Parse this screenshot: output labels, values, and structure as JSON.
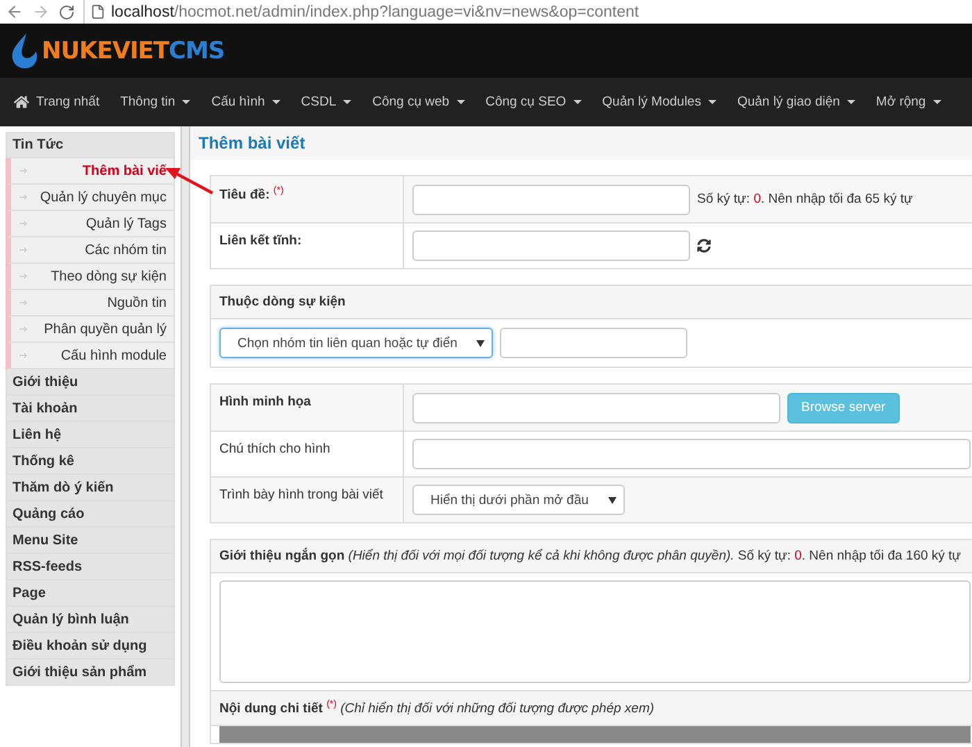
{
  "browser": {
    "host": "localhost",
    "path": "/hocmot.net/admin/index.php?language=vi&nv=news&op=content"
  },
  "logo": {
    "brand": "NUKEVIET",
    "suffix": "CMS"
  },
  "nav": [
    {
      "label": "Trang nhất",
      "kind": "home"
    },
    {
      "label": "Thông tin",
      "kind": "menu"
    },
    {
      "label": "Cấu hình",
      "kind": "menu"
    },
    {
      "label": "CSDL",
      "kind": "menu"
    },
    {
      "label": "Công cụ web",
      "kind": "menu"
    },
    {
      "label": "Công cụ SEO",
      "kind": "menu"
    },
    {
      "label": "Quản lý Modules",
      "kind": "menu"
    },
    {
      "label": "Quản lý giao diện",
      "kind": "menu"
    },
    {
      "label": "Mở rộng",
      "kind": "menu"
    }
  ],
  "sidebar": {
    "items": [
      {
        "label": "Tin Tức",
        "children": [
          {
            "label": "Thêm bài viế",
            "selected": true
          },
          {
            "label": "Quản lý chuyên mục",
            "selected": false
          },
          {
            "label": "Quản lý Tags",
            "selected": false
          },
          {
            "label": "Các nhóm tin",
            "selected": false
          },
          {
            "label": "Theo dòng sự kiện",
            "selected": false
          },
          {
            "label": "Nguồn tin",
            "selected": false
          },
          {
            "label": "Phân quyền quản lý",
            "selected": false
          },
          {
            "label": "Cấu hình module",
            "selected": false
          }
        ]
      },
      {
        "label": "Giới thiệu"
      },
      {
        "label": "Tài khoản"
      },
      {
        "label": "Liên hệ"
      },
      {
        "label": "Thống kê"
      },
      {
        "label": "Thăm dò ý kiến"
      },
      {
        "label": "Quảng cáo"
      },
      {
        "label": "Menu Site"
      },
      {
        "label": "RSS-feeds"
      },
      {
        "label": "Page"
      },
      {
        "label": "Quản lý bình luận"
      },
      {
        "label": "Điều khoản sử dụng"
      },
      {
        "label": "Giới thiệu sản phẩm"
      }
    ]
  },
  "page_title": "Thêm bài viết",
  "title_row": {
    "label": "Tiêu đề:",
    "required_mark": "(*)",
    "hint_prefix": "Số ký tự: ",
    "count": "0",
    "hint_suffix": ". Nên nhập tối đa 65 ký tự"
  },
  "slug_row": {
    "label": "Liên kết tĩnh:"
  },
  "event_panel": {
    "heading": "Thuộc dòng sự kiện",
    "select": "Chọn nhóm tin liên quan hoặc tự điển"
  },
  "image_rows": [
    {
      "label": "Hình minh họa",
      "kind": "file",
      "bold": true,
      "button": "Browse server"
    },
    {
      "label": "Chú thích cho hình",
      "kind": "text",
      "bold": false
    },
    {
      "label": "Trình bày hình trong bài viết",
      "kind": "select",
      "bold": false,
      "value": "Hiển thị dưới phần mở đầu"
    }
  ],
  "intro_panel": {
    "label": "Giới thiệu ngắn gọn",
    "note": "(Hiển thị đối với mọi đối tượng kể cả khi không được phân quyền).",
    "hint_prefix": " Số ký tự: ",
    "count": "0",
    "hint_suffix": ". Nên nhập tối đa 160 ký tự"
  },
  "content_panel": {
    "label": "Nội dung chi tiết",
    "required_mark": "(*)",
    "note": "(Chỉ hiển thị đối với những đối tượng được phép xem)"
  }
}
